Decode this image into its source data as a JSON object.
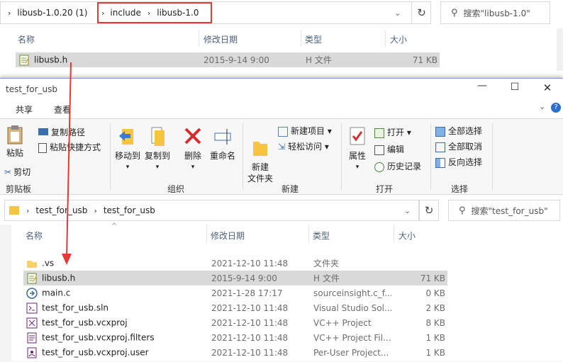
{
  "back_window": {
    "address": {
      "crumbs": [
        "libusb-1.0.20 (1)",
        "include",
        "libusb-1.0"
      ]
    },
    "search_placeholder": "搜索\"libusb-1.0\"",
    "columns": [
      "名称",
      "修改日期",
      "类型",
      "大小"
    ],
    "rows": [
      {
        "name": "libusb.h",
        "date": "2015-9-14 9:00",
        "type": "H 文件",
        "size": "71 KB"
      }
    ]
  },
  "front_window": {
    "title": "test_for_usb",
    "tabs": [
      "共享",
      "查看"
    ],
    "ribbon": {
      "clipboard": {
        "paste": "粘贴",
        "copy_path": "复制路径",
        "paste_shortcut": "粘贴快捷方式",
        "cut": "剪切",
        "label": "剪贴板"
      },
      "organize": {
        "move_to": "移动到",
        "copy_to": "复制到",
        "delete": "删除",
        "rename": "重命名",
        "label": "组织"
      },
      "new": {
        "new_item": "新建项目",
        "easy_access": "轻松访问",
        "new_folder": "新建\n文件夹",
        "label": "新建"
      },
      "open": {
        "properties": "属性",
        "open": "打开",
        "edit": "编辑",
        "history": "历史记录",
        "label": "打开"
      },
      "select": {
        "select_all": "全部选择",
        "select_none": "全部取消",
        "invert": "反向选择",
        "label": "选择"
      }
    },
    "address": {
      "crumbs": [
        "test_for_usb",
        "test_for_usb"
      ]
    },
    "search_placeholder": "搜索\"test_for_usb\"",
    "columns": [
      "名称",
      "修改日期",
      "类型",
      "大小"
    ],
    "rows": [
      {
        "name": ".vs",
        "date": "2021-12-10 11:48",
        "type": "文件夹",
        "size": "",
        "icon": "folder-icon"
      },
      {
        "name": "libusb.h",
        "date": "2015-9-14 9:00",
        "type": "H 文件",
        "size": "71 KB",
        "icon": "header-file-icon"
      },
      {
        "name": "main.c",
        "date": "2021-1-28 17:17",
        "type": "sourceinsight.c_f...",
        "size": "0 KB",
        "icon": "c-file-icon"
      },
      {
        "name": "test_for_usb.sln",
        "date": "2021-12-10 11:48",
        "type": "Visual Studio Sol...",
        "size": "2 KB",
        "icon": "sln-file-icon"
      },
      {
        "name": "test_for_usb.vcxproj",
        "date": "2021-12-10 11:48",
        "type": "VC++ Project",
        "size": "8 KB",
        "icon": "vcxproj-file-icon"
      },
      {
        "name": "test_for_usb.vcxproj.filters",
        "date": "2021-12-10 11:48",
        "type": "VC++ Project Fil...",
        "size": "1 KB",
        "icon": "filters-file-icon"
      },
      {
        "name": "test_for_usb.vcxproj.user",
        "date": "2021-12-10 11:48",
        "type": "Per-User Project...",
        "size": "1 KB",
        "icon": "user-file-icon"
      }
    ]
  },
  "colors": {
    "highlight_box": "#e53935",
    "arrow": "#e53935",
    "selection": "#d9d9d9"
  }
}
